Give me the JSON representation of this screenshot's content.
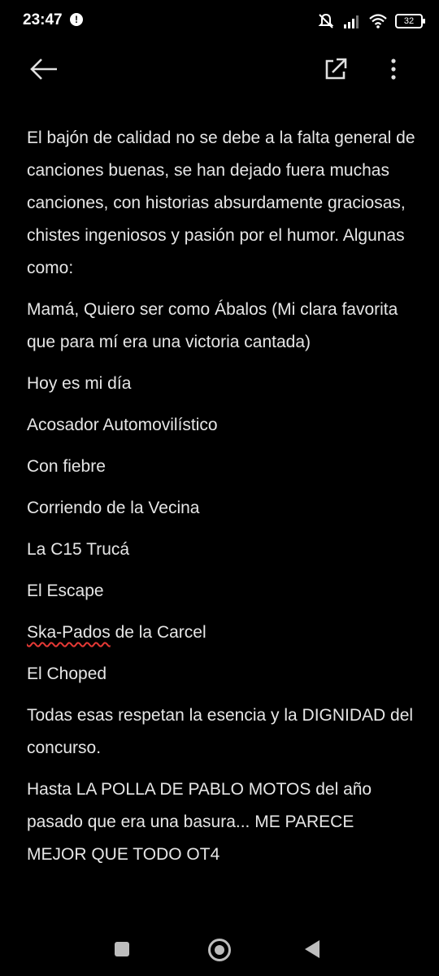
{
  "status": {
    "time": "23:47",
    "battery": "32",
    "icons": [
      "alert-icon",
      "mute-icon",
      "signal-icon",
      "wifi-icon",
      "battery-icon"
    ]
  },
  "appbar": {
    "icons": [
      "back-arrow-icon",
      "open-external-icon",
      "more-vert-icon"
    ]
  },
  "content": {
    "intro": "El bajón de calidad no se debe a la falta general de canciones buenas, se han dejado fuera muchas canciones, con historias absurdamente graciosas, chistes ingeniosos y pasión por el humor. Algunas como:",
    "songs": [
      "Mamá, Quiero ser como Ábalos (Mi clara favorita que para mí era una victoria cantada)",
      "Hoy es mi día",
      "Acosador Automovilístico",
      "Con fiebre",
      "Corriendo de la Vecina",
      "La C15 Trucá",
      "El Escape"
    ],
    "ska_word": "Ska-Pados",
    "ska_rest": " de la Carcel",
    "choped": "El Choped",
    "respect": "Todas esas respetan la esencia y la DIGNIDAD del concurso.",
    "closing": "Hasta LA POLLA DE PABLO MOTOS del año pasado que era una basura... ME PARECE MEJOR QUE TODO OT4"
  },
  "navbar": {
    "icons": [
      "recent-apps-icon",
      "home-icon",
      "back-icon"
    ]
  }
}
